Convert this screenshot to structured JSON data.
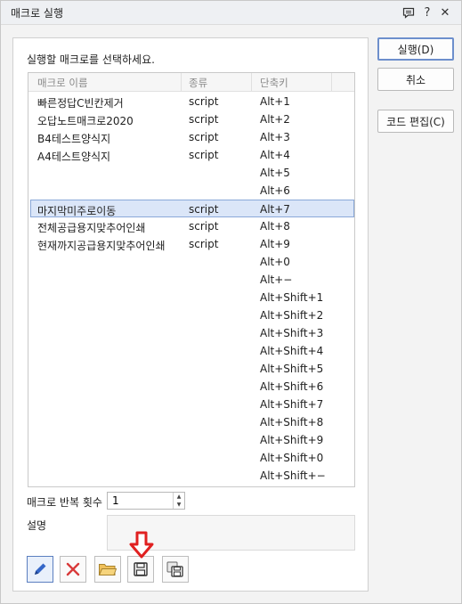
{
  "window": {
    "title": "매크로 실행"
  },
  "titlebar_icons": [
    "comment-icon",
    "help-icon",
    "close-icon"
  ],
  "titlebar_glyphs": {
    "help": "?",
    "close": "✕"
  },
  "prompt": "실행할 매크로를 선택하세요.",
  "list": {
    "columns": [
      "매크로 이름",
      "종류",
      "단축키"
    ],
    "rows": [
      {
        "name": "빠른정답C빈칸제거",
        "type": "script",
        "key": "Alt+1"
      },
      {
        "name": "오답노트매크로2020",
        "type": "script",
        "key": "Alt+2"
      },
      {
        "name": "B4테스트양식지",
        "type": "script",
        "key": "Alt+3"
      },
      {
        "name": "A4테스트양식지",
        "type": "script",
        "key": "Alt+4"
      },
      {
        "name": "",
        "type": "",
        "key": "Alt+5"
      },
      {
        "name": "",
        "type": "",
        "key": "Alt+6"
      },
      {
        "name": "마지막미주로이동",
        "type": "script",
        "key": "Alt+7",
        "selected": true
      },
      {
        "name": "전체공급용지맞추어인쇄",
        "type": "script",
        "key": "Alt+8"
      },
      {
        "name": "현재까지공급용지맞추어인쇄",
        "type": "script",
        "key": "Alt+9"
      },
      {
        "name": "",
        "type": "",
        "key": "Alt+0"
      },
      {
        "name": "",
        "type": "",
        "key": "Alt+−"
      },
      {
        "name": "",
        "type": "",
        "key": "Alt+Shift+1"
      },
      {
        "name": "",
        "type": "",
        "key": "Alt+Shift+2"
      },
      {
        "name": "",
        "type": "",
        "key": "Alt+Shift+3"
      },
      {
        "name": "",
        "type": "",
        "key": "Alt+Shift+4"
      },
      {
        "name": "",
        "type": "",
        "key": "Alt+Shift+5"
      },
      {
        "name": "",
        "type": "",
        "key": "Alt+Shift+6"
      },
      {
        "name": "",
        "type": "",
        "key": "Alt+Shift+7"
      },
      {
        "name": "",
        "type": "",
        "key": "Alt+Shift+8"
      },
      {
        "name": "",
        "type": "",
        "key": "Alt+Shift+9"
      },
      {
        "name": "",
        "type": "",
        "key": "Alt+Shift+0"
      },
      {
        "name": "",
        "type": "",
        "key": "Alt+Shift+−"
      }
    ]
  },
  "repeat": {
    "label": "매크로 반복 횟수",
    "value": "1"
  },
  "description": {
    "label": "설명",
    "value": ""
  },
  "toolbar": {
    "icons": [
      "edit-pencil-icon",
      "delete-x-icon",
      "open-folder-icon",
      "save-disk-icon",
      "save-as-icon"
    ],
    "active_index": 0
  },
  "buttons": {
    "run": "실행(D)",
    "cancel": "취소",
    "edit_code": "코드 편집(C)"
  },
  "colors": {
    "selection_bg": "#dbe6f8",
    "selection_border": "#8aa8d8",
    "pencil_blue": "#3466c8",
    "delete_red": "#d83a3a",
    "folder_yellow": "#f0c05a",
    "arrow_red": "#e02020"
  }
}
